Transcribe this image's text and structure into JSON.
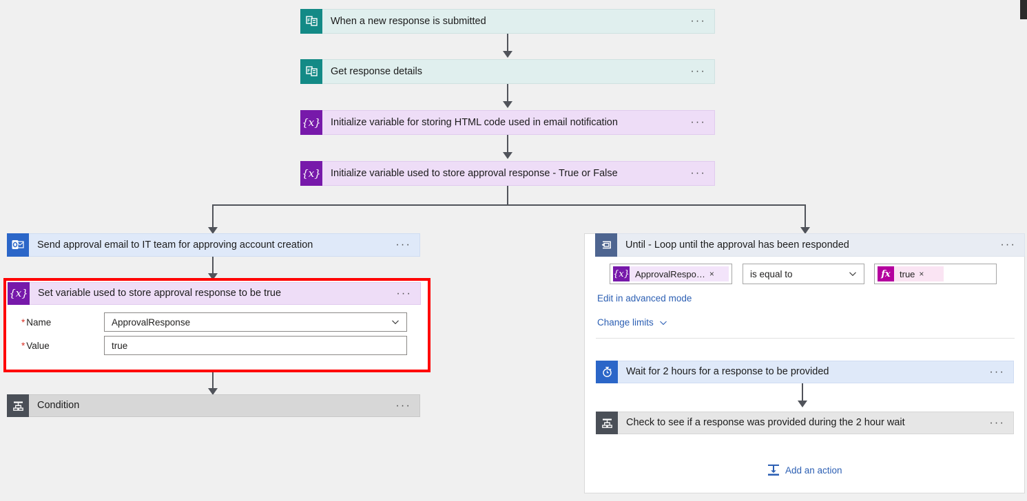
{
  "flow": {
    "trigger": {
      "label": "When a new response is submitted",
      "icon": "microsoft-forms-icon",
      "menu": "···"
    },
    "steps": [
      {
        "label": "Get response details",
        "icon": "microsoft-forms-icon",
        "menu": "···"
      },
      {
        "label": "Initialize variable for storing HTML code used in email notification",
        "icon": "variable-icon",
        "glyph": "{x}",
        "menu": "···"
      },
      {
        "label": "Initialize variable used to store approval response - True or False",
        "icon": "variable-icon",
        "glyph": "{x}",
        "menu": "···"
      }
    ],
    "left_branch": {
      "send_email": {
        "label": "Send approval email to IT team for approving account creation",
        "icon": "outlook-icon",
        "menu": "···"
      },
      "set_variable": {
        "label": "Set variable used to store approval response to be true",
        "icon": "variable-icon",
        "glyph": "{x}",
        "menu": "···",
        "highlighted": true,
        "highlight_color": "#ff0000",
        "fields": [
          {
            "label": "Name",
            "required": "*",
            "value": "ApprovalResponse",
            "control": "dropdown"
          },
          {
            "label": "Value",
            "required": "*",
            "value": "true",
            "control": "textbox"
          }
        ]
      },
      "condition": {
        "label": "Condition",
        "icon": "condition-icon",
        "menu": "···"
      }
    },
    "right_branch": {
      "until": {
        "label": "Until - Loop until the approval has been responded",
        "icon": "until-loop-icon",
        "menu": "···",
        "condition": {
          "left_token": {
            "glyph": "{x}",
            "text": "ApprovalRespo…",
            "remove": "×"
          },
          "operator": "is equal to",
          "right_token": {
            "glyph": "fx",
            "text": "true",
            "remove": "×"
          }
        },
        "advanced_link": "Edit in advanced mode",
        "change_limits": "Change limits",
        "actions": [
          {
            "label": "Wait for 2 hours for a response to be provided",
            "icon": "delay-clock-icon",
            "menu": "···"
          },
          {
            "label": "Check to see if a response was provided during the 2 hour wait",
            "icon": "condition-icon",
            "menu": "···"
          }
        ],
        "add_action": "Add an action"
      }
    }
  },
  "colors": {
    "forms_teal": "#138a86",
    "variable_purple": "#7719aa",
    "outlook_blue": "#2b66c8",
    "condition_gray": "#4a4f57",
    "until_blue": "#4e6590",
    "fx_magenta": "#b4009e",
    "link_blue": "#2c5fb3",
    "highlight_red": "#ff0000",
    "connector_gray": "#50535a",
    "canvas_bg": "#f0f0f0"
  }
}
